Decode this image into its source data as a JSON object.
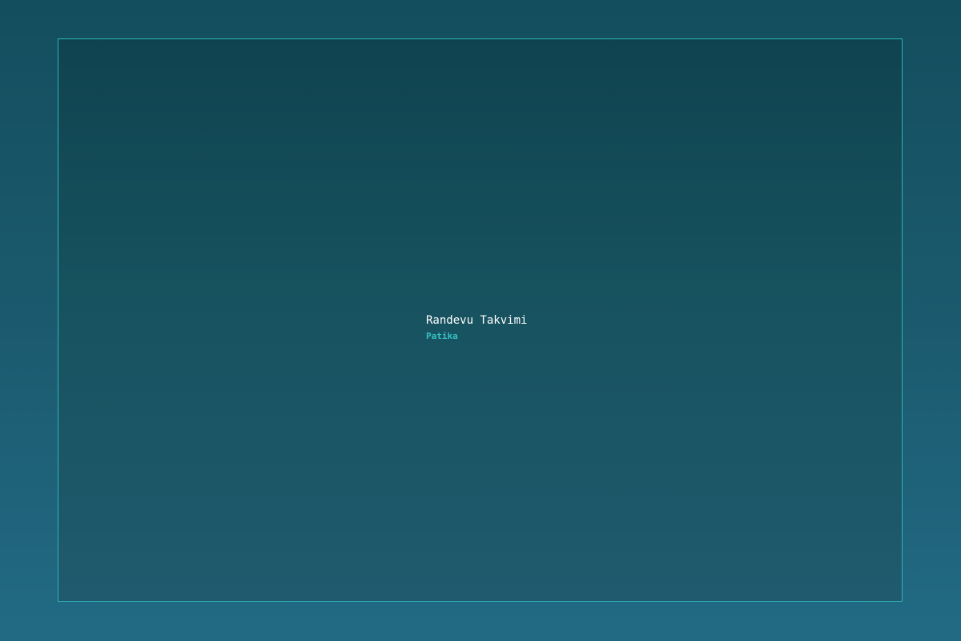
{
  "app": {
    "title": "Randevu Takvimi",
    "subtitle": "Patika"
  },
  "colors": {
    "accent": "#35c2c4",
    "frame_border": "#2fb3b5",
    "text": "#ffffff"
  }
}
